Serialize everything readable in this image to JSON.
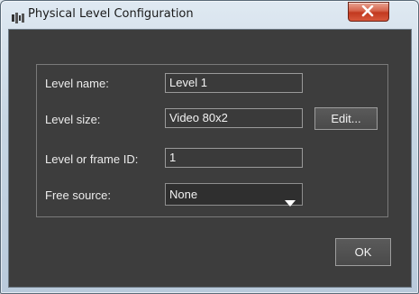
{
  "window": {
    "title": "Physical Level Configuration",
    "close_label": "x"
  },
  "form": {
    "level_name": {
      "label": "Level name:",
      "value": "Level 1"
    },
    "level_size": {
      "label": "Level size:",
      "value": "Video 80x2",
      "edit_label": "Edit..."
    },
    "level_or_frame_id": {
      "label": "Level or frame ID:",
      "value": "1"
    },
    "free_source": {
      "label": "Free source:",
      "value": "None"
    }
  },
  "footer": {
    "ok_label": "OK"
  },
  "icons": {
    "app": "app-icon",
    "close": "close-icon",
    "dropdown": "chevron-down-icon"
  },
  "colors": {
    "client_bg": "#3d3d3d",
    "text": "#ececec",
    "close_button": "#c7432a"
  }
}
